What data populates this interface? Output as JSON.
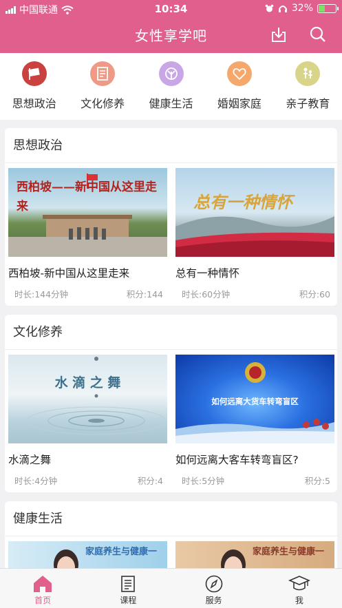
{
  "status": {
    "carrier": "中国联通",
    "time": "10:34",
    "battery": "32%"
  },
  "header": {
    "title": "女性享学吧"
  },
  "categories": [
    {
      "label": "思想政治",
      "icon": "flag-icon",
      "color": "#c9423f"
    },
    {
      "label": "文化修养",
      "icon": "book-icon",
      "color": "#ef9a86"
    },
    {
      "label": "健康生活",
      "icon": "leaf-icon",
      "color": "#c9a7e6"
    },
    {
      "label": "婚姻家庭",
      "icon": "heart-icon",
      "color": "#f6a86c"
    },
    {
      "label": "亲子教育",
      "icon": "family-icon",
      "color": "#d8d48a"
    }
  ],
  "sections": [
    {
      "title": "思想政治",
      "items": [
        {
          "title": "西柏坡-新中国从这里走来",
          "duration": "时长:144分钟",
          "points": "积分:144",
          "thumb_text": "西柏坡——新中国从这里走来"
        },
        {
          "title": "总有一种情怀",
          "duration": "时长:60分钟",
          "points": "积分:60",
          "thumb_text": "总有一种情怀"
        }
      ]
    },
    {
      "title": "文化修养",
      "items": [
        {
          "title": "水滴之舞",
          "duration": "时长:4分钟",
          "points": "积分:4",
          "thumb_text": "水 滴 之 舞"
        },
        {
          "title": "如何远离大客车转弯盲区?",
          "duration": "时长:5分钟",
          "points": "积分:5",
          "thumb_text": "如何远离大货车转弯盲区"
        }
      ]
    },
    {
      "title": "健康生活",
      "items": [
        {
          "thumb_text": "家庭养生与健康一"
        },
        {
          "thumb_text": "家庭养生与健康一"
        }
      ]
    }
  ],
  "tabs": [
    {
      "label": "首页",
      "icon": "home-icon"
    },
    {
      "label": "课程",
      "icon": "course-icon"
    },
    {
      "label": "服务",
      "icon": "compass-icon"
    },
    {
      "label": "我",
      "icon": "profile-icon"
    }
  ],
  "colors": {
    "brand": "#e05f8c",
    "background": "#f1f1f3"
  }
}
